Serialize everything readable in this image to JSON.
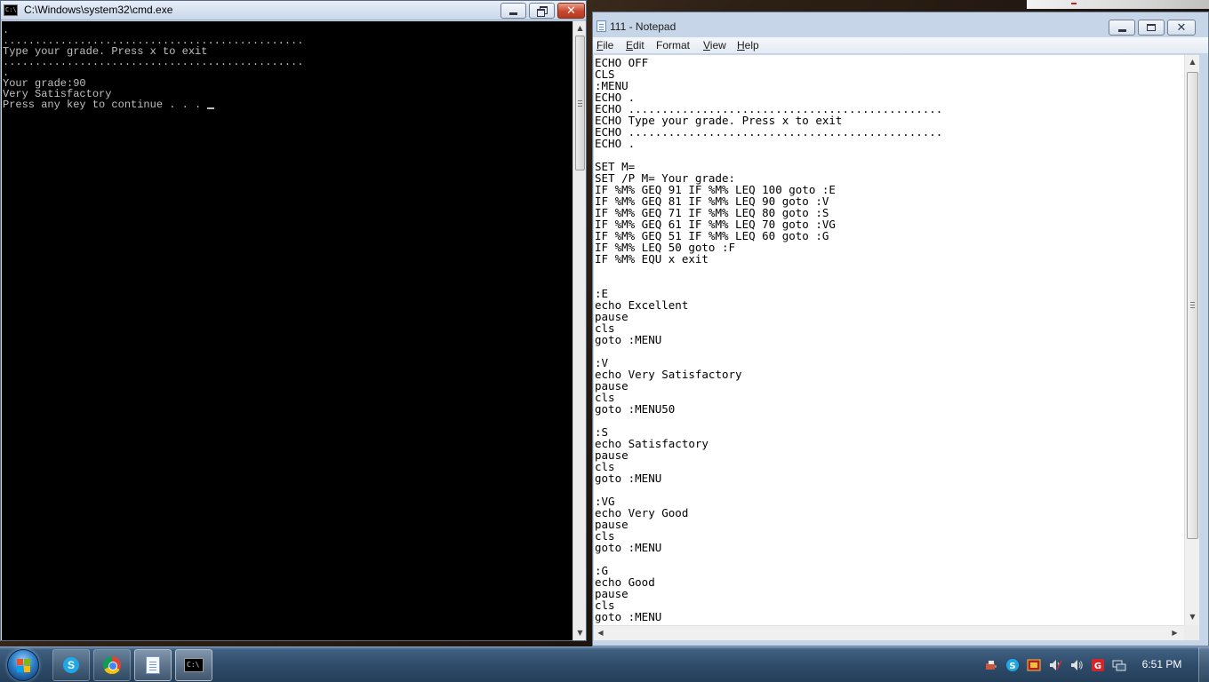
{
  "cmd": {
    "title": "C:\\Windows\\system32\\cmd.exe",
    "icon_text": "C:\\",
    "lines": [
      ".",
      "...............................................",
      "Type your grade. Press x to exit",
      "...............................................",
      ".",
      "Your grade:90",
      "Very Satisfactory",
      "Press any key to continue . . . "
    ],
    "text_color": "#c0c0c0",
    "background": "#000000"
  },
  "notepad": {
    "title": "111 - Notepad",
    "menu": [
      {
        "label": "File",
        "key": "F",
        "rest": "ile"
      },
      {
        "label": "Edit",
        "key": "E",
        "rest": "dit"
      },
      {
        "label": "Format",
        "key": "",
        "rest": "Format"
      },
      {
        "label": "View",
        "key": "V",
        "rest": "iew"
      },
      {
        "label": "Help",
        "key": "H",
        "rest": "elp"
      }
    ],
    "lines": [
      "ECHO OFF",
      "CLS",
      ":MENU",
      "ECHO .",
      "ECHO ...............................................",
      "ECHO Type your grade. Press x to exit",
      "ECHO ...............................................",
      "ECHO .",
      "",
      "SET M=",
      "SET /P M= Your grade:",
      "IF %M% GEQ 91 IF %M% LEQ 100 goto :E",
      "IF %M% GEQ 81 IF %M% LEQ 90 goto :V",
      "IF %M% GEQ 71 IF %M% LEQ 80 goto :S",
      "IF %M% GEQ 61 IF %M% LEQ 70 goto :VG",
      "IF %M% GEQ 51 IF %M% LEQ 60 goto :G",
      "IF %M% LEQ 50 goto :F",
      "IF %M% EQU x exit",
      "",
      "",
      ":E",
      "echo Excellent",
      "pause",
      "cls",
      "goto :MENU",
      "",
      ":V",
      "echo Very Satisfactory",
      "pause",
      "cls",
      "goto :MENU50",
      "",
      ":S",
      "echo Satisfactory",
      "pause",
      "cls",
      "goto :MENU",
      "",
      ":VG",
      "echo Very Good",
      "pause",
      "cls",
      "goto :MENU",
      "",
      ":G",
      "echo Good",
      "pause",
      "cls",
      "goto :MENU"
    ]
  },
  "taskbar": {
    "clock": "6:51 PM",
    "pinned": [
      "skype-icon",
      "chrome-icon",
      "notepad-icon",
      "cmd-icon"
    ],
    "cmd_icon_text": "C:\\"
  },
  "colors": {
    "taskbar": "#2d4a68",
    "close_button": "#c6462c",
    "window_frame": "#c9d6e6"
  }
}
